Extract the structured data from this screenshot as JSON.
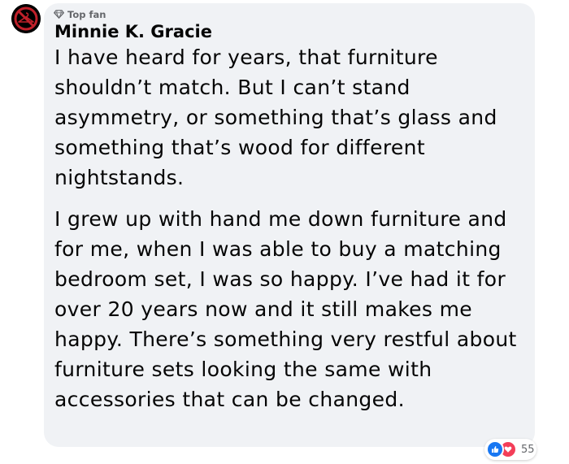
{
  "comment": {
    "badge": "Top fan",
    "author": "Minnie K. Gracie",
    "paragraphs": [
      "I have heard for years, that furniture shouldn’t match. But I can’t stand asymmetry, or something that’s glass and something that’s wood for different nightstands.",
      "I grew up with hand me down furniture and for me, when I was able to buy a matching bedroom set, I was so happy. I’ve had it for over 20 years now and it still makes me happy. There’s something very restful about furniture sets looking the same with accessories that can be changed."
    ],
    "reactions": {
      "icons": [
        "like-icon",
        "love-icon"
      ],
      "count": "55"
    }
  },
  "colors": {
    "bubble": "#f0f2f5",
    "avatar_bg": "#000000",
    "avatar_ring": "#c0202a",
    "like": "#1877f2",
    "love": "#f33e58",
    "muted_text": "#65676b"
  },
  "icons": {
    "avatar": "hanger-prohibited-icon",
    "badge": "diamond-icon"
  }
}
